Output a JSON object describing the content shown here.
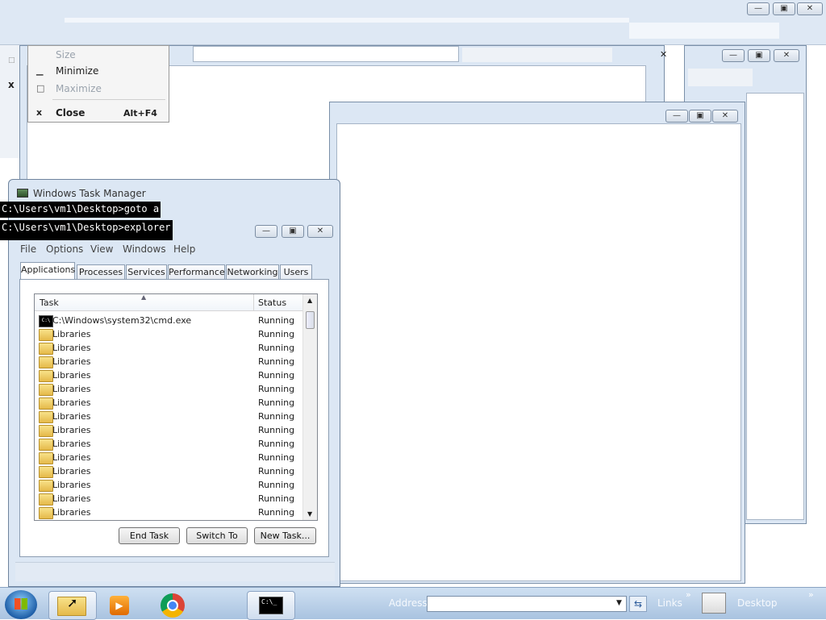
{
  "sys_menu": {
    "items": [
      {
        "icon": "",
        "label": "Size",
        "shortcut": "",
        "disabled": true
      },
      {
        "icon": "minimize-icon",
        "label": "Minimize",
        "shortcut": "",
        "disabled": false
      },
      {
        "icon": "maximize-icon",
        "label": "Maximize",
        "shortcut": "",
        "disabled": true
      },
      {
        "icon": "close-icon",
        "label": "Close",
        "shortcut": "Alt+F4",
        "disabled": false,
        "bold": true
      }
    ]
  },
  "cmd": {
    "line1": "C:\\Users\\vm1\\Desktop>goto a",
    "line2": "C:\\Users\\vm1\\Desktop>explorer"
  },
  "task_manager": {
    "title": "Windows Task Manager",
    "menu": [
      "File",
      "Options",
      "View",
      "Windows",
      "Help"
    ],
    "tabs": [
      "Applications",
      "Processes",
      "Services",
      "Performance",
      "Networking",
      "Users"
    ],
    "active_tab": "Applications",
    "columns": {
      "task": "Task",
      "status": "Status"
    },
    "rows": [
      {
        "icon": "cmd-icon",
        "task": "C:\\Windows\\system32\\cmd.exe",
        "status": "Running"
      },
      {
        "icon": "folder-icon",
        "task": "Libraries",
        "status": "Running"
      },
      {
        "icon": "folder-icon",
        "task": "Libraries",
        "status": "Running"
      },
      {
        "icon": "folder-icon",
        "task": "Libraries",
        "status": "Running"
      },
      {
        "icon": "folder-icon",
        "task": "Libraries",
        "status": "Running"
      },
      {
        "icon": "folder-icon",
        "task": "Libraries",
        "status": "Running"
      },
      {
        "icon": "folder-icon",
        "task": "Libraries",
        "status": "Running"
      },
      {
        "icon": "folder-icon",
        "task": "Libraries",
        "status": "Running"
      },
      {
        "icon": "folder-icon",
        "task": "Libraries",
        "status": "Running"
      },
      {
        "icon": "folder-icon",
        "task": "Libraries",
        "status": "Running"
      },
      {
        "icon": "folder-icon",
        "task": "Libraries",
        "status": "Running"
      },
      {
        "icon": "folder-icon",
        "task": "Libraries",
        "status": "Running"
      },
      {
        "icon": "folder-icon",
        "task": "Libraries",
        "status": "Running"
      },
      {
        "icon": "folder-icon",
        "task": "Libraries",
        "status": "Running"
      },
      {
        "icon": "folder-icon",
        "task": "Libraries",
        "status": "Running"
      }
    ],
    "buttons": {
      "end_task": "End Task",
      "switch_to": "Switch To",
      "new_task": "New Task..."
    }
  },
  "taskbar": {
    "address_label": "Address",
    "address_value": "",
    "links_label": "Links",
    "desktop_label": "Desktop",
    "chevron": "»",
    "cmd_icon_text": "C:\\_"
  },
  "colors": {
    "window_frame": "#dce7f4",
    "taskbar": "#b9cde5",
    "cmd_background": "#000000"
  }
}
